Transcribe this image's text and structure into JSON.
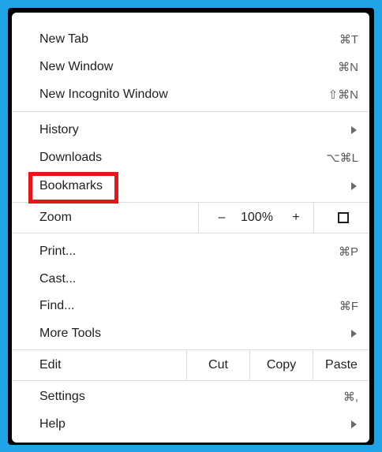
{
  "menu": {
    "new_tab": {
      "label": "New Tab",
      "shortcut": "⌘T"
    },
    "new_window": {
      "label": "New Window",
      "shortcut": "⌘N"
    },
    "new_incognito": {
      "label": "New Incognito Window",
      "shortcut": "⇧⌘N"
    },
    "history": {
      "label": "History"
    },
    "downloads": {
      "label": "Downloads",
      "shortcut": "⌥⌘L"
    },
    "bookmarks": {
      "label": "Bookmarks"
    },
    "zoom": {
      "label": "Zoom",
      "minus": "–",
      "level": "100%",
      "plus": "+"
    },
    "print": {
      "label": "Print...",
      "shortcut": "⌘P"
    },
    "cast": {
      "label": "Cast..."
    },
    "find": {
      "label": "Find...",
      "shortcut": "⌘F"
    },
    "more_tools": {
      "label": "More Tools"
    },
    "edit": {
      "label": "Edit",
      "cut": "Cut",
      "copy": "Copy",
      "paste": "Paste"
    },
    "settings": {
      "label": "Settings",
      "shortcut": "⌘,"
    },
    "help": {
      "label": "Help"
    }
  },
  "colors": {
    "frame": "#1fa3e6",
    "highlight": "#e8141a"
  }
}
